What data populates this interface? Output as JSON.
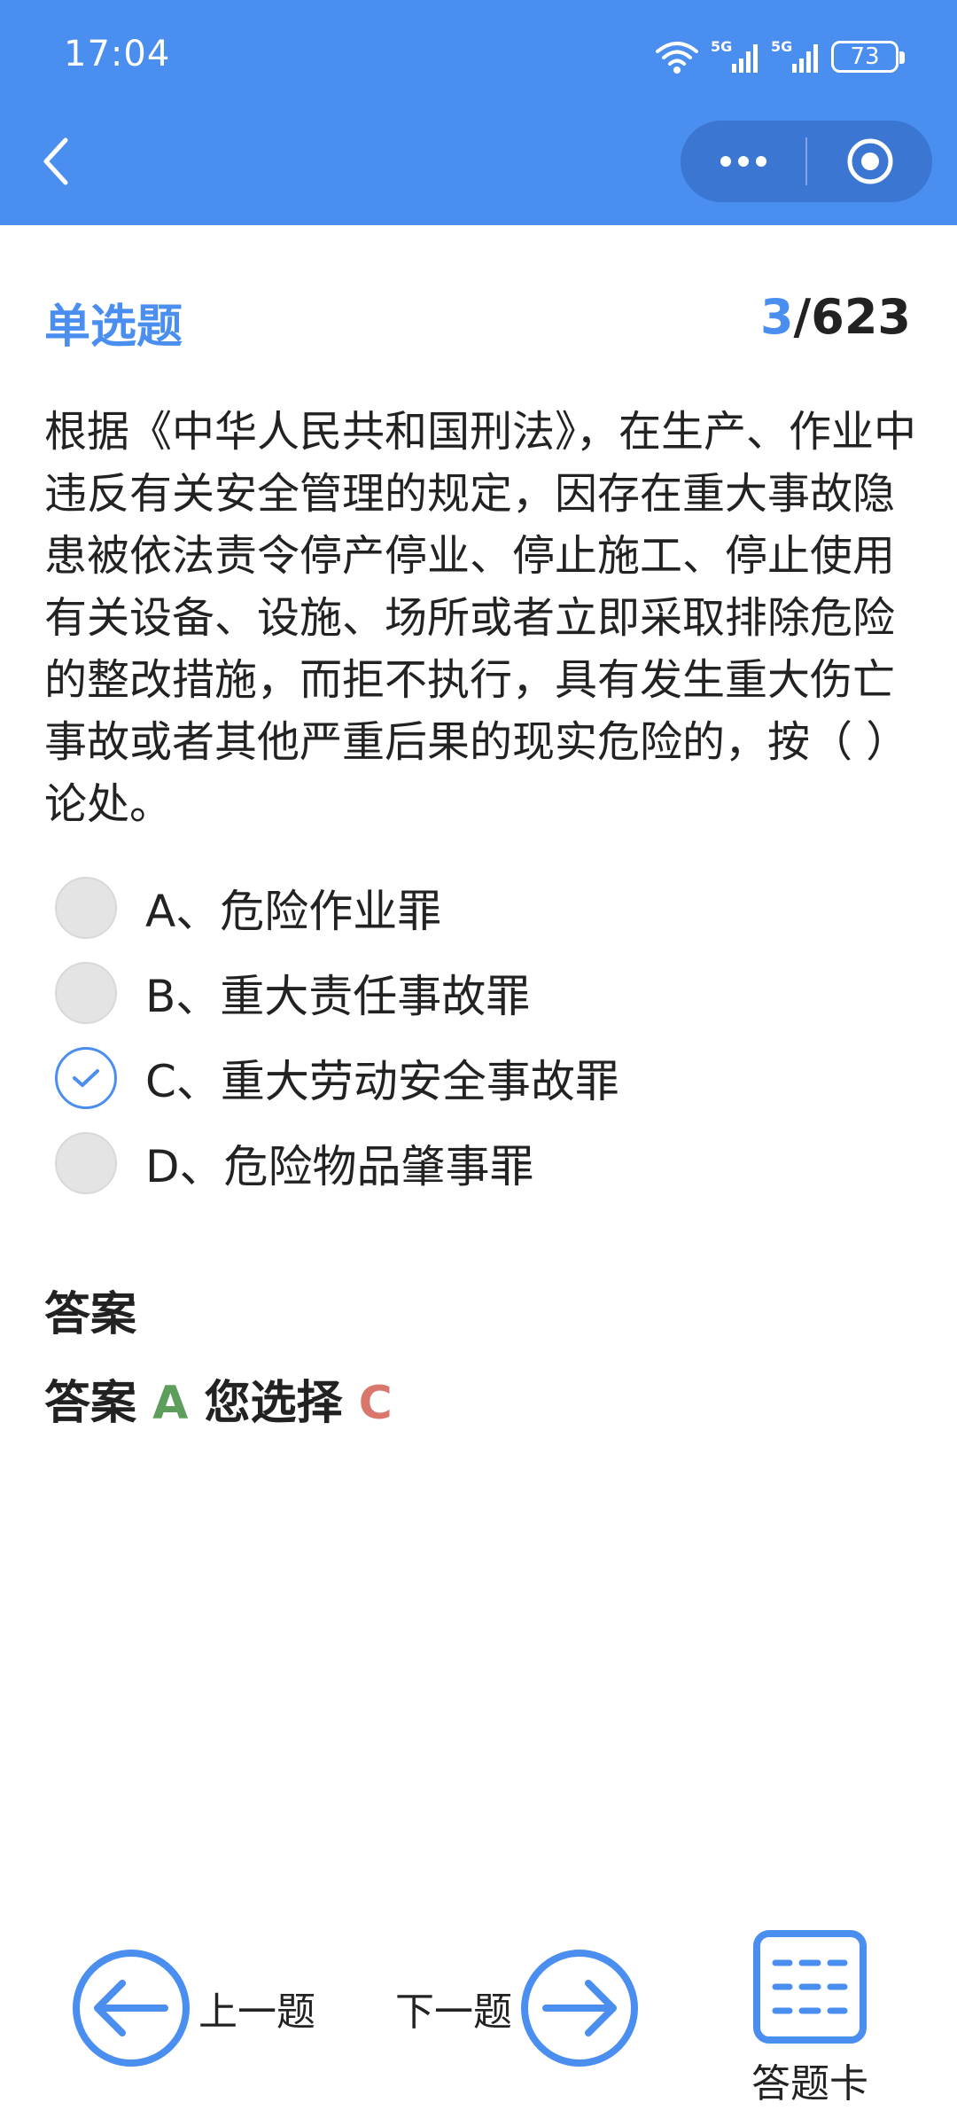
{
  "status_bar": {
    "time": "17:04",
    "battery": "73"
  },
  "question": {
    "type_label": "单选题",
    "current": "3",
    "separator_total": "/623",
    "text": "根据《中华人民共和国刑法》，在生产、作业中违反有关安全管理的规定，因存在重大事故隐患被依法责令停产停业、停止施工、停止使用有关设备、设施、场所或者立即采取排除危险的整改措施，而拒不执行，具有发生重大伤亡事故或者其他严重后果的现实危险的，按（ ）论处。",
    "options": [
      {
        "label": "A、危险作业罪",
        "selected": false
      },
      {
        "label": "B、重大责任事故罪",
        "selected": false
      },
      {
        "label": "C、重大劳动安全事故罪",
        "selected": true
      },
      {
        "label": "D、危险物品肇事罪",
        "selected": false
      }
    ]
  },
  "answer": {
    "title": "答案",
    "prefix": "答案",
    "correct": "A",
    "chosen_prefix": "您选择",
    "chosen": "C"
  },
  "nav": {
    "prev_label": "上一题",
    "next_label": "下一题",
    "card_label": "答题卡"
  },
  "colors": {
    "accent": "#4a8ef0",
    "capsule": "#3a76d2",
    "correct": "#5e9e5c",
    "chosen": "#d9776d"
  },
  "icons": {
    "back": "chevron-left-icon",
    "more": "more-dots-icon",
    "close": "target-circle-icon",
    "prev": "arrow-left-circle-icon",
    "next": "arrow-right-circle-icon",
    "card": "grid-card-icon",
    "wifi": "wifi-icon",
    "signal": "signal-5g-icon",
    "check": "check-icon"
  }
}
